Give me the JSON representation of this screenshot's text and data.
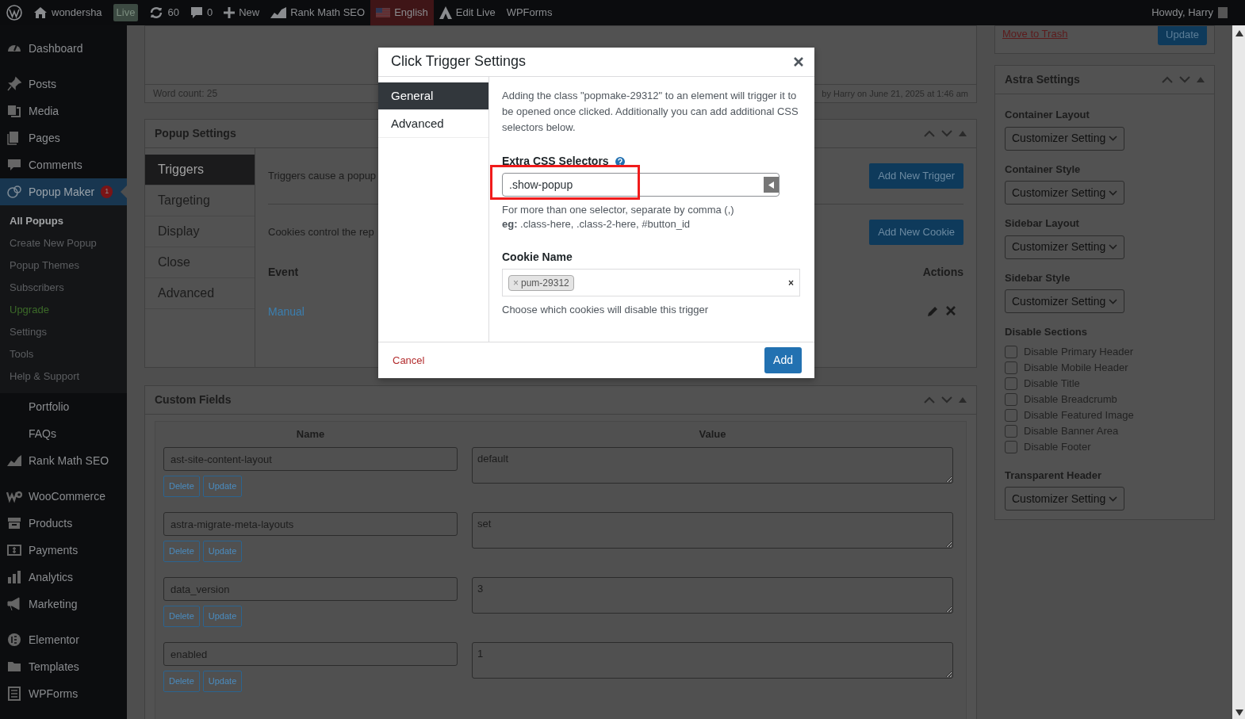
{
  "admin_bar": {
    "items": [
      {
        "kind": "logo"
      },
      {
        "kind": "site",
        "label": "wondersha"
      },
      {
        "kind": "badge",
        "label": "Live"
      },
      {
        "kind": "updates",
        "label": "60"
      },
      {
        "kind": "comments",
        "label": "0"
      },
      {
        "kind": "new",
        "label": "New"
      },
      {
        "kind": "seo",
        "label": "Rank Math SEO"
      },
      {
        "kind": "language",
        "label": "English"
      },
      {
        "kind": "builder",
        "label": "Edit Live"
      },
      {
        "kind": "text",
        "label": "WPForms"
      }
    ],
    "greeting": "Howdy, Harry"
  },
  "sidebar": {
    "groups": [
      {
        "items": [
          {
            "label": "Dashboard",
            "selected": false
          }
        ]
      },
      {
        "items": [
          {
            "label": "Posts",
            "selected": false
          },
          {
            "label": "Media",
            "selected": false
          },
          {
            "label": "Pages",
            "selected": false
          },
          {
            "label": "Comments",
            "selected": false
          },
          {
            "label": "Popup Maker",
            "selected": true,
            "count": "1",
            "submenu": [
              {
                "label": "All Popups",
                "kind": "link",
                "selected": true
              },
              {
                "label": "Create New Popup",
                "kind": "link",
                "selected": false
              },
              {
                "label": "Popup Themes",
                "kind": "link",
                "selected": false
              },
              {
                "label": "Subscribers",
                "kind": "link",
                "selected": false
              },
              {
                "label": "Upgrade",
                "kind": "upgrade",
                "selected": false
              },
              {
                "label": "Settings",
                "kind": "link",
                "selected": false
              },
              {
                "label": "Tools",
                "kind": "link",
                "selected": false
              },
              {
                "label": "Help & Support",
                "kind": "link",
                "selected": false
              }
            ]
          },
          {
            "label": "Portfolio",
            "selected": false
          },
          {
            "label": "FAQs",
            "selected": false
          },
          {
            "label": "Rank Math SEO",
            "selected": false
          }
        ]
      },
      {
        "items": [
          {
            "label": "WooCommerce",
            "selected": false
          },
          {
            "label": "Products",
            "selected": false
          },
          {
            "label": "Payments",
            "selected": false
          },
          {
            "label": "Analytics",
            "selected": false
          },
          {
            "label": "Marketing",
            "selected": false
          }
        ]
      },
      {
        "items": [
          {
            "label": "Elementor",
            "selected": false
          },
          {
            "label": "Templates",
            "selected": false
          },
          {
            "label": "WPForms",
            "selected": false
          }
        ]
      }
    ]
  },
  "editor_box": {
    "word_count": "Word count: 25",
    "last_edited": "by Harry on June 21, 2025 at 1:46 am"
  },
  "popup_settings": {
    "title": "Popup Settings",
    "tabs": [
      {
        "label": "Triggers",
        "selected": true
      },
      {
        "label": "Targeting",
        "selected": false
      },
      {
        "label": "Display",
        "selected": false
      },
      {
        "label": "Close",
        "selected": false
      },
      {
        "label": "Advanced",
        "selected": false
      }
    ],
    "triggers_text": "Triggers cause a popup",
    "add_trigger": "Add New Trigger",
    "cookies_text": "Cookies control the rep",
    "add_cookie": "Add New Cookie",
    "columns": [
      "Event",
      "Actions"
    ],
    "rows": [
      {
        "event": "Manual"
      }
    ]
  },
  "custom_fields": {
    "title": "Custom Fields",
    "columns": [
      "Name",
      "Value"
    ],
    "rows": [
      {
        "name": "ast-site-content-layout",
        "value": "default",
        "buttons": [
          "Delete",
          "Update"
        ]
      },
      {
        "name": "astra-migrate-meta-layouts",
        "value": "set",
        "buttons": [
          "Delete",
          "Update"
        ]
      },
      {
        "name": "data_version",
        "value": "3",
        "buttons": [
          "Delete",
          "Update"
        ]
      },
      {
        "name": "enabled",
        "value": "1",
        "buttons": [
          "Delete",
          "Update"
        ]
      }
    ]
  },
  "publish_box": {
    "trash_link": "Move to Trash",
    "update_button": "Update"
  },
  "astra_settings": {
    "title": "Astra Settings",
    "fields": [
      {
        "kind": "select",
        "label": "Container Layout",
        "value": "Customizer Setting"
      },
      {
        "kind": "select",
        "label": "Container Style",
        "value": "Customizer Setting"
      },
      {
        "kind": "select",
        "label": "Sidebar Layout",
        "value": "Customizer Setting"
      },
      {
        "kind": "select",
        "label": "Sidebar Style",
        "value": "Customizer Setting"
      },
      {
        "kind": "checkboxes",
        "label": "Disable Sections",
        "options": [
          {
            "label": "Disable Primary Header",
            "checked": false
          },
          {
            "label": "Disable Mobile Header",
            "checked": false
          },
          {
            "label": "Disable Title",
            "checked": false
          },
          {
            "label": "Disable Breadcrumb",
            "checked": false
          },
          {
            "label": "Disable Featured Image",
            "checked": false
          },
          {
            "label": "Disable Banner Area",
            "checked": false
          },
          {
            "label": "Disable Footer",
            "checked": false
          }
        ]
      },
      {
        "kind": "select",
        "label": "Transparent Header",
        "value": "Customizer Setting"
      }
    ]
  },
  "modal": {
    "title": "Click Trigger Settings",
    "tabs": [
      {
        "label": "General",
        "selected": true
      },
      {
        "label": "Advanced",
        "selected": false
      }
    ],
    "description": "Adding the class \"popmake-29312\" to an element will trigger it to be opened once clicked. Additionally you can add additional CSS selectors below.",
    "css_field": {
      "label": "Extra CSS Selectors",
      "value": ".show-popup",
      "help": [
        "For more than one selector, separate by comma (,)",
        "**eg:** .class-here, .class-2-here, #button_id"
      ]
    },
    "cookie_field": {
      "label": "Cookie Name",
      "tags": [
        {
          "remove": "×",
          "label": "pum-29312"
        }
      ],
      "clear": "×",
      "help": "Choose which cookies will disable this trigger"
    },
    "cancel": "Cancel",
    "add": "Add"
  }
}
